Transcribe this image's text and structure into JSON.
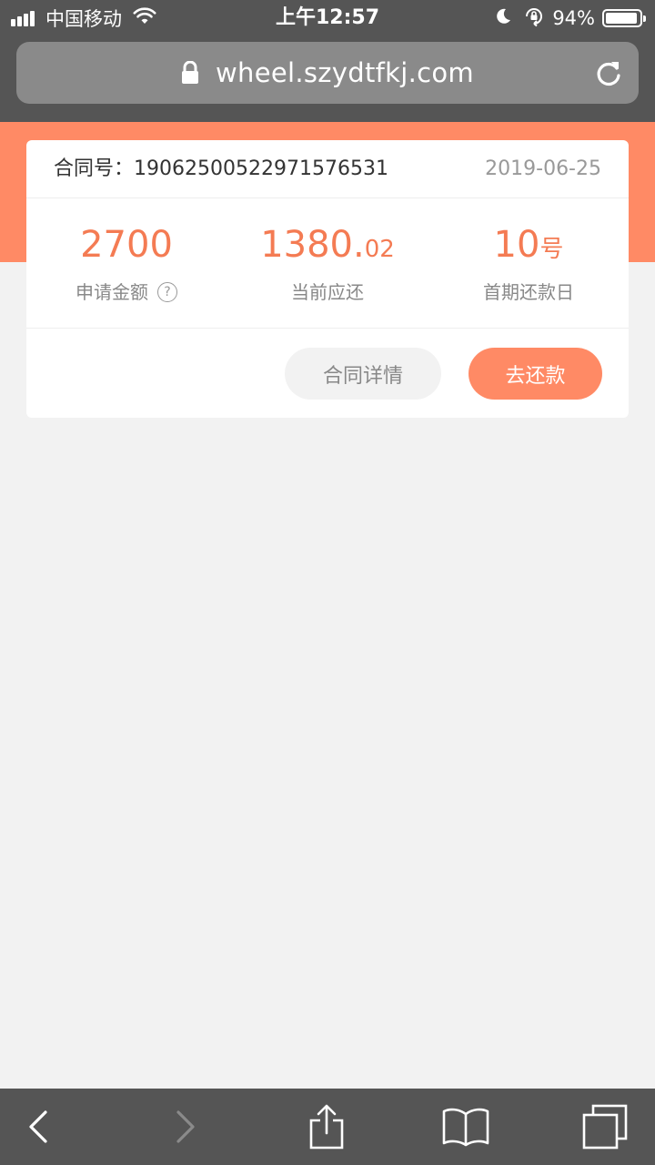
{
  "status_bar": {
    "carrier": "中国移动",
    "time": "上午12:57",
    "battery_percent": "94%",
    "battery_level": 0.94,
    "icons": [
      "signal-icon",
      "wifi-icon",
      "moon-icon",
      "rotation-lock-icon",
      "battery-icon"
    ]
  },
  "browser": {
    "url": "wheel.szydtfkj.com",
    "icons": [
      "lock-icon",
      "reload-icon"
    ],
    "toolbar_icons": [
      "back-icon",
      "forward-icon",
      "share-icon",
      "bookmarks-icon",
      "tabs-icon"
    ]
  },
  "contract": {
    "label": "合同号：",
    "number": "19062500522971576531",
    "date": "2019-06-25"
  },
  "stats": {
    "amount": {
      "value": "2700",
      "label": "申请金额",
      "help_icon": "?"
    },
    "current_due": {
      "value_main": "1380.",
      "value_decimal": "02",
      "label": "当前应还"
    },
    "first_due_day": {
      "value_main": "10",
      "value_unit": "号",
      "label": "首期还款日"
    }
  },
  "actions": {
    "detail": "合同详情",
    "pay": "去还款"
  },
  "colors": {
    "accent": "#ff8a65",
    "accent_text": "#f47b53",
    "chrome": "#555555",
    "background": "#f2f2f2"
  }
}
